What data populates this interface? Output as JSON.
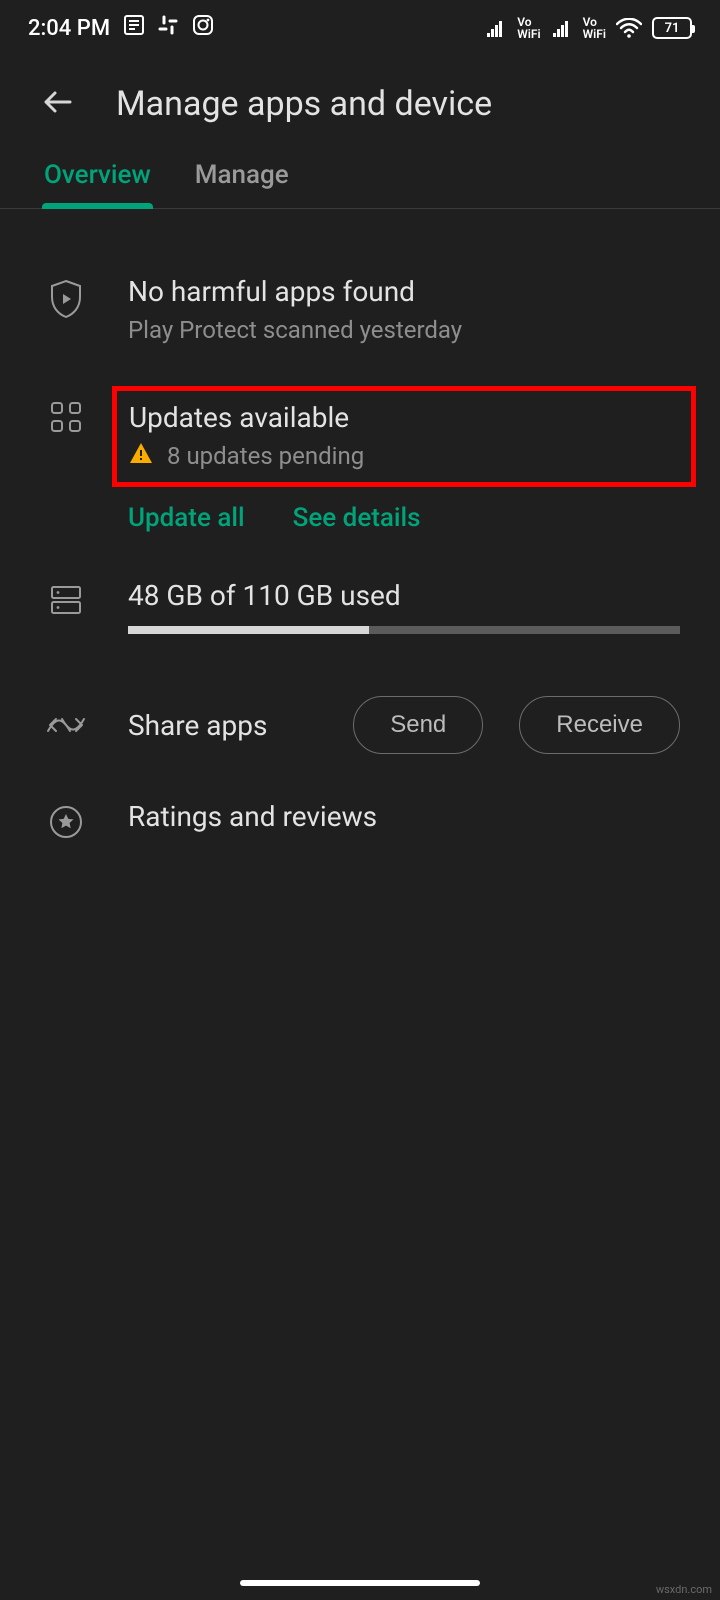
{
  "status": {
    "time": "2:04 PM",
    "battery": "71"
  },
  "header": {
    "title": "Manage apps and device"
  },
  "tabs": {
    "overview": "Overview",
    "manage": "Manage"
  },
  "protect": {
    "title": "No harmful apps found",
    "subtitle": "Play Protect scanned yesterday"
  },
  "updates": {
    "title": "Updates available",
    "pending_text": "8 updates pending",
    "update_all": "Update all",
    "see_details": "See details"
  },
  "storage": {
    "label": "48 GB of 110 GB used",
    "used": 48,
    "total": 110
  },
  "share": {
    "label": "Share apps",
    "send": "Send",
    "receive": "Receive"
  },
  "ratings": {
    "label": "Ratings and reviews"
  },
  "watermark": "wsxdn.com"
}
